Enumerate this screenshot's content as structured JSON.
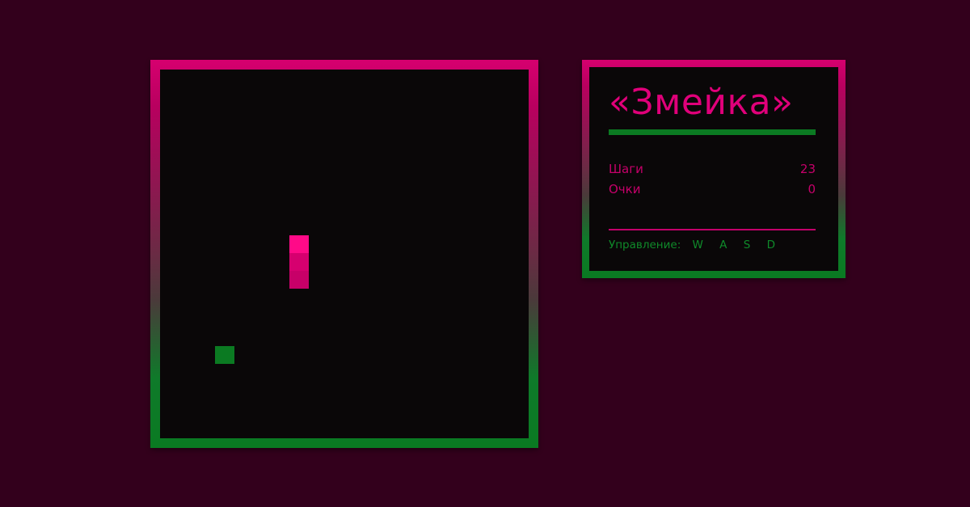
{
  "game": {
    "title": "«Змейка»",
    "stats": [
      {
        "label": "Шаги",
        "value": "23"
      },
      {
        "label": "Очки",
        "value": "0"
      }
    ],
    "controls_label": "Управление:",
    "controls_keys": "W A S D"
  },
  "colors": {
    "background": "#33001c",
    "board": "#0a0708",
    "accent_pink": "#e0007a",
    "accent_green": "#0b7a22"
  }
}
